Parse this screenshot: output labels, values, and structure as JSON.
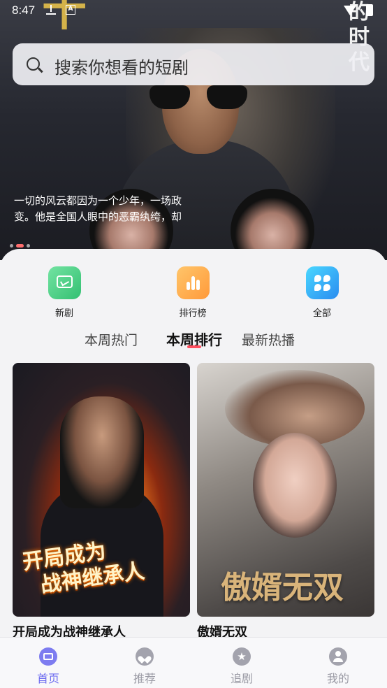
{
  "status_bar": {
    "time": "8:47",
    "keyboard_badge": "A"
  },
  "hero": {
    "poster_title_fragment": "十",
    "side_title": "的时代",
    "description": "一切的风云都因为一个少年，一场政变。他是全国人眼中的恶霸纨绔，却",
    "carousel_count": 3,
    "carousel_active_index": 1
  },
  "search": {
    "placeholder": "搜索你想看的短剧"
  },
  "categories": [
    {
      "label": "新剧",
      "icon": "tv-icon",
      "color": "#33c072"
    },
    {
      "label": "排行榜",
      "icon": "bar-chart-icon",
      "color": "#ff9a3a"
    },
    {
      "label": "全部",
      "icon": "grid-icon",
      "color": "#2a8cf0"
    }
  ],
  "tabs": [
    {
      "label": "本周热门",
      "active": false
    },
    {
      "label": "本周排行",
      "active": true
    },
    {
      "label": "最新热播",
      "active": false
    }
  ],
  "accent_color": "#ff4f5f",
  "dramas": [
    {
      "title": "开局成为战神继承人",
      "poster_text": "开局成为战神继承人"
    },
    {
      "title": "傲婿无双",
      "poster_text": "傲婿无双"
    }
  ],
  "bottom_nav": [
    {
      "label": "首页",
      "icon": "home-tv-icon",
      "active": true
    },
    {
      "label": "推荐",
      "icon": "heart-icon",
      "active": false
    },
    {
      "label": "追剧",
      "icon": "star-icon",
      "active": false
    },
    {
      "label": "我的",
      "icon": "user-icon",
      "active": false
    }
  ],
  "nav_active_color": "#6e6cf0"
}
